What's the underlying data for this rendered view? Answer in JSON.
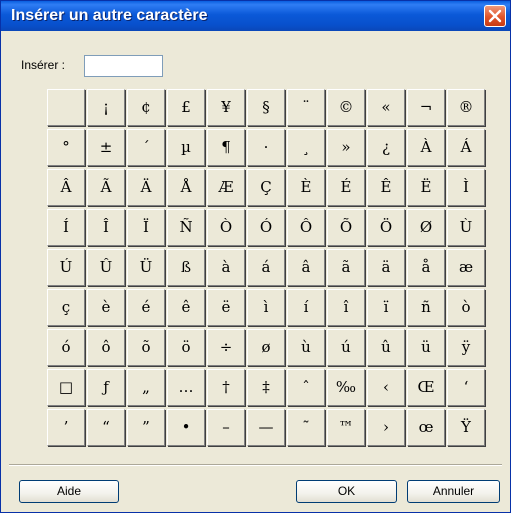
{
  "window": {
    "title": "Insérer un autre caractère"
  },
  "insert": {
    "label": "Insérer :",
    "value": ""
  },
  "characters": [
    [
      "",
      "¡",
      "¢",
      "£",
      "¥",
      "§",
      "¨",
      "©",
      "«",
      "¬",
      "®"
    ],
    [
      "°",
      "±",
      "´",
      "µ",
      "¶",
      "·",
      "¸",
      "»",
      "¿",
      "À",
      "Á"
    ],
    [
      "Â",
      "Ã",
      "Ä",
      "Å",
      "Æ",
      "Ç",
      "È",
      "É",
      "Ê",
      "Ë",
      "Ì"
    ],
    [
      "Í",
      "Î",
      "Ï",
      "Ñ",
      "Ò",
      "Ó",
      "Ô",
      "Õ",
      "Ö",
      "Ø",
      "Ù"
    ],
    [
      "Ú",
      "Û",
      "Ü",
      "ß",
      "à",
      "á",
      "â",
      "ã",
      "ä",
      "å",
      "æ"
    ],
    [
      "ç",
      "è",
      "é",
      "ê",
      "ë",
      "ì",
      "í",
      "î",
      "ï",
      "ñ",
      "ò"
    ],
    [
      "ó",
      "ô",
      "õ",
      "ö",
      "÷",
      "ø",
      "ù",
      "ú",
      "û",
      "ü",
      "ÿ"
    ],
    [
      "□",
      "ƒ",
      "„",
      "…",
      "†",
      "‡",
      "ˆ",
      "‰",
      "‹",
      "Œ",
      "‘"
    ],
    [
      "’",
      "“",
      "”",
      "•",
      "–",
      "—",
      "˜",
      "™",
      "›",
      "œ",
      "Ÿ"
    ]
  ],
  "buttons": {
    "help": "Aide",
    "ok": "OK",
    "cancel": "Annuler"
  }
}
